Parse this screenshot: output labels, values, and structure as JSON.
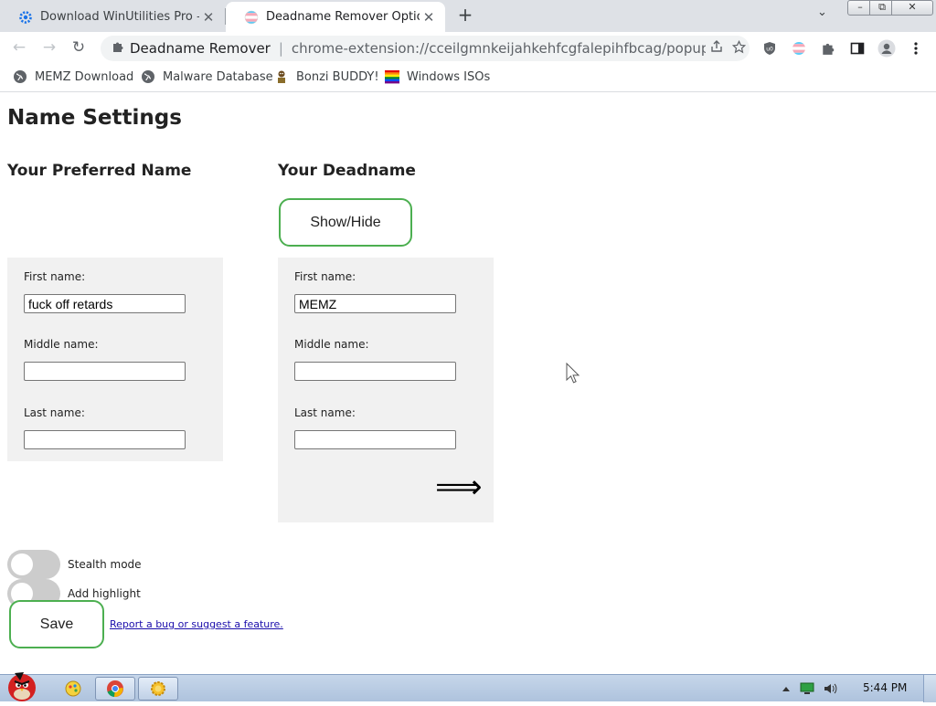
{
  "browser": {
    "tabs": [
      {
        "title": "Download WinUtilities Pro – Y",
        "favicon": "gear-icon",
        "active": false
      },
      {
        "title": "Deadname Remover Options",
        "favicon": "trans-flag-icon",
        "active": true
      }
    ],
    "new_tab": "+",
    "tab_close": "✕",
    "tab_search": "⌄",
    "window_controls": {
      "minimize": "–",
      "maximize": "⧉",
      "close": "✕"
    },
    "nav": {
      "back": "←",
      "forward": "→",
      "reload": "↻"
    },
    "omnibox": {
      "extension_name": "Deadname Remover",
      "separator": "|",
      "url": "chrome-extension://cceilgmnkeijahkehfcgfalepihfbcag/popup/opt..."
    },
    "bookmarks": [
      {
        "label": "MEMZ Download",
        "icon": "globe-icon"
      },
      {
        "label": "Malware Database",
        "icon": "globe-icon"
      },
      {
        "label": "Bonzi BUDDY!",
        "icon": "bonzi-icon"
      },
      {
        "label": "Windows ISOs",
        "icon": "rainbow-flag-icon"
      }
    ]
  },
  "page": {
    "title": "Name Settings",
    "preferred": {
      "heading": "Your Preferred Name",
      "first_label": "First name:",
      "first_value": "fuck off retards",
      "middle_label": "Middle name:",
      "middle_value": "",
      "last_label": "Last name:",
      "last_value": ""
    },
    "deadname": {
      "heading": "Your Deadname",
      "show_hide": "Show/Hide",
      "first_label": "First name:",
      "first_value": "MEMZ",
      "middle_label": "Middle name:",
      "middle_value": "",
      "last_label": "Last name:",
      "last_value": "",
      "arrow": "⟹"
    },
    "toggles": [
      {
        "label": "Stealth mode",
        "on": false
      },
      {
        "label": "Add highlight",
        "on": false
      }
    ],
    "save": "Save",
    "report_link": "Report a bug or suggest a feature."
  },
  "taskbar": {
    "clock": "5:44 PM",
    "apps": [
      "angry-bird-start-icon",
      "paint-icon",
      "chrome-icon",
      "sun-gear-icon"
    ]
  },
  "colors": {
    "tabstrip": "#dee1e6",
    "button_border": "#4caf50",
    "box_background": "#f1f1f1",
    "toggle_off": "#cccccc",
    "link": "#1a0dab"
  }
}
